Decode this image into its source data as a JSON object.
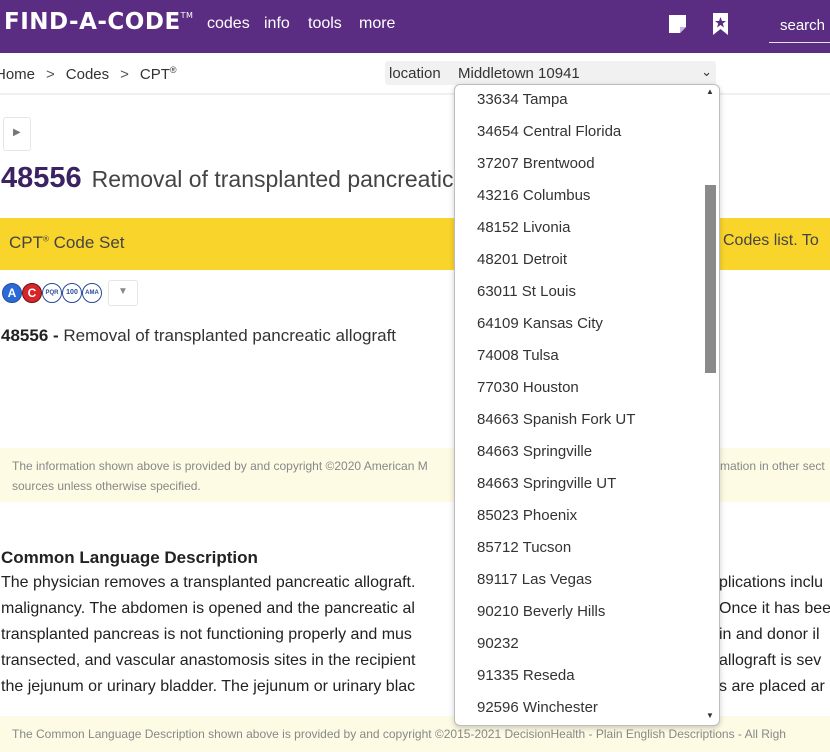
{
  "header": {
    "logo": "FIND-A-CODE",
    "logo_tm": "TM",
    "nav": [
      "codes",
      "info",
      "tools",
      "more"
    ],
    "icons": [
      "note-icon",
      "bookmark-icon"
    ],
    "search_label": "search",
    "bg_color": "#5a2d82"
  },
  "breadcrumb": {
    "home": "Home",
    "sep": ">",
    "codes": "Codes",
    "cpt": "CPT",
    "cpt_mark": "®"
  },
  "location": {
    "label": "location",
    "value": "Middletown 10941",
    "options": [
      "33634 Tampa",
      "34654 Central Florida",
      "37207 Brentwood",
      "43216 Columbus",
      "48152 Livonia",
      "48201 Detroit",
      "63011 St Louis",
      "64109 Kansas City",
      "74008 Tulsa",
      "77030 Houston",
      "84663 Spanish Fork UT",
      "84663 Springville",
      "84663 Springville UT",
      "85023 Phoenix",
      "85712 Tucson",
      "89117 Las Vegas",
      "90210 Beverly Hills",
      "90232",
      "91335 Reseda",
      "92596 Winchester"
    ]
  },
  "code": {
    "number": "48556",
    "title_partial": "Removal of transplanted pancreatic",
    "line_number": "48556 -",
    "line_desc": "Removal of transplanted pancreatic allograft"
  },
  "code_set_bar": {
    "left": "CPT",
    "left_mark": "®",
    "left_rest": " Code Set",
    "right": "ly Codes list. To",
    "color": "#f9d52c"
  },
  "badges": [
    "A",
    "C",
    "PQR",
    "100",
    "AMA"
  ],
  "notes": {
    "ama_l1": "The information shown above is provided by and copyright ©2020 American M",
    "ama_l2": "sources unless otherwise specified.",
    "ama_r1": "mation in other sect",
    "dh_l1": "The Common Language Description shown above is provided by and copyright ©2015-2021 DecisionHealth - Plain English Descriptions - All Righ"
  },
  "common_language": {
    "heading": "Common Language Description",
    "left_lines": [
      "The physician removes a transplanted pancreatic allograft.",
      "malignancy. The abdomen is opened and the pancreatic al",
      "transplanted pancreas is not functioning properly and mus",
      "transected, and vascular anastomosis sites in the recipient",
      "the jejunum or urinary bladder. The jejunum or urinary blac"
    ],
    "right_lines": [
      "plications inclu",
      "Once it has bee",
      "in and donor il",
      "allograft is sev",
      "s are placed ar"
    ]
  }
}
